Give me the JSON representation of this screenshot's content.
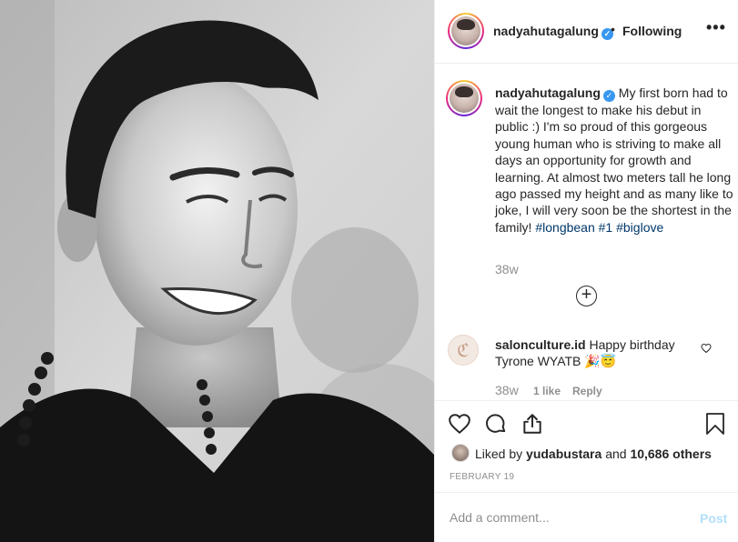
{
  "photo": {
    "alt": ""
  },
  "header": {
    "username": "nadyahutagalung",
    "separator": "•",
    "follow_state": "Following",
    "more": "•••"
  },
  "caption": {
    "username": "nadyahutagalung",
    "text": "My first born had to wait the longest to make his debut in public :) I'm so proud of this gorgeous young human who is striving to make all days an opportunity for growth and learning. At almost two meters tall he long ago passed my height and as many like to joke, I will very soon be the shortest in the family!",
    "hashtags": [
      "#longbean",
      "#1",
      "#biglove"
    ],
    "time": "38w"
  },
  "load_more": "+",
  "comment": {
    "avatar_glyph": "ℭ",
    "username": "salonculture.id",
    "text": "Happy birthday Tyrone WYATB 🎉😇",
    "time": "38w",
    "likes": "1 like",
    "reply": "Reply"
  },
  "likes": {
    "prefix": "Liked by",
    "user": "yudabustara",
    "joiner": "and",
    "others": "10,686 others"
  },
  "date": "FEBRUARY 19",
  "add_comment": {
    "placeholder": "Add a comment...",
    "post": "Post"
  },
  "colors": {
    "verified": "#3897f0",
    "hashtag": "#00376b",
    "post_disabled": "#b2dffc",
    "muted": "#8e8e8e"
  }
}
